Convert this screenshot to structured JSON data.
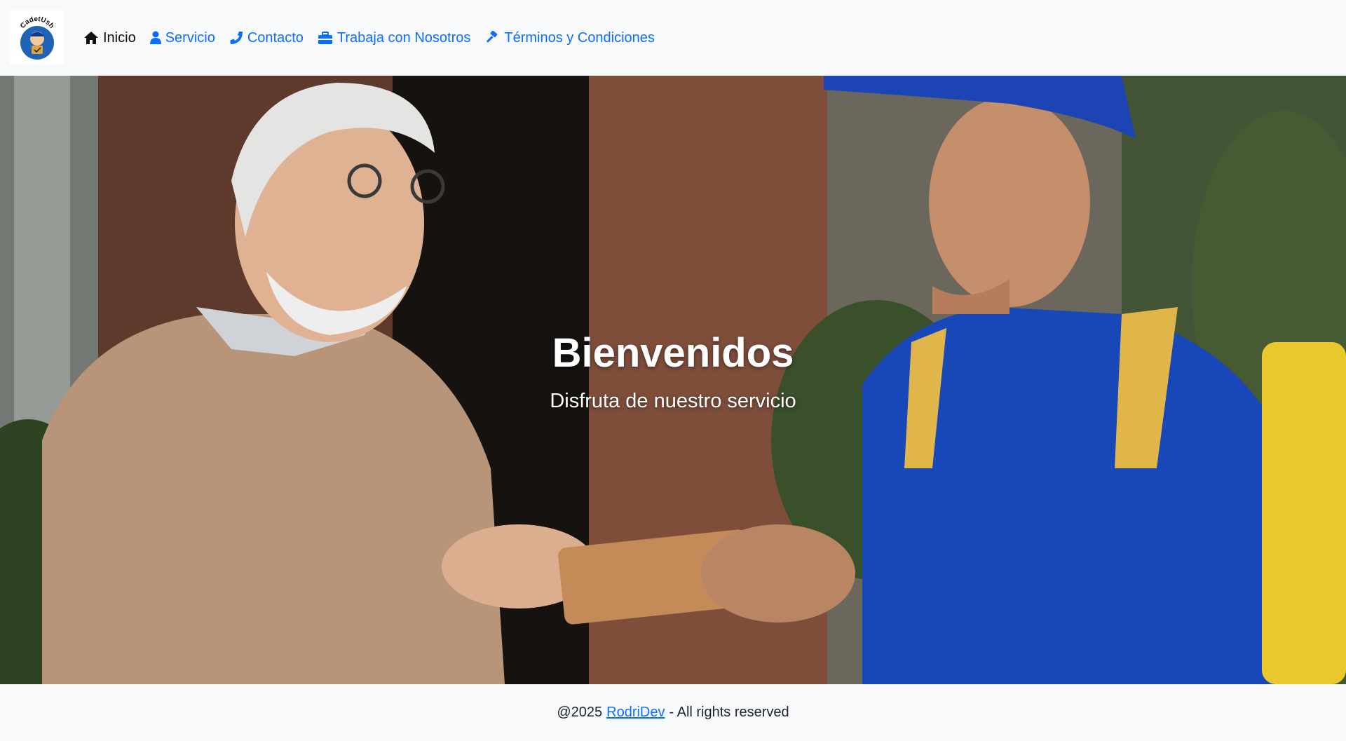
{
  "brand": {
    "logo_text": "CadetUsh",
    "logo_icon": "delivery-person-logo"
  },
  "nav": {
    "items": [
      {
        "label": "Inicio",
        "icon": "home-icon",
        "active": true
      },
      {
        "label": "Servicio",
        "icon": "user-icon",
        "active": false
      },
      {
        "label": "Contacto",
        "icon": "phone-icon",
        "active": false
      },
      {
        "label": "Trabaja con Nosotros",
        "icon": "toolbox-icon",
        "active": false
      },
      {
        "label": "Términos y Condiciones",
        "icon": "gavel-icon",
        "active": false
      }
    ]
  },
  "hero": {
    "title": "Bienvenidos",
    "subtitle": "Disfruta de nuestro servicio"
  },
  "footer": {
    "prefix": "@2025",
    "link": "RodriDev",
    "suffix": "- All rights reserved"
  },
  "colors": {
    "link": "#0d6efd",
    "active": "#111111",
    "background": "#f8f9fa"
  }
}
